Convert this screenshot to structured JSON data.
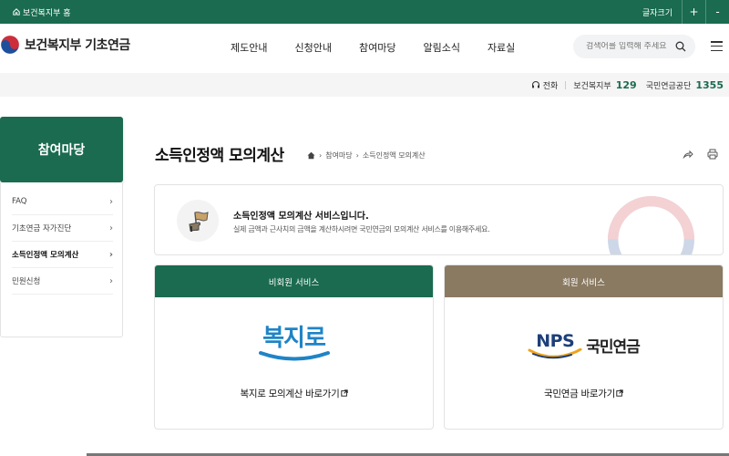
{
  "topbar": {
    "home_link": "보건복지부 홈",
    "font_size_label": "글자크기",
    "font_plus": "+",
    "font_minus": "-"
  },
  "header": {
    "logo_text": "보건복지부 기초연금",
    "nav": [
      "제도안내",
      "신청안내",
      "참여마당",
      "알림소식",
      "자료실"
    ],
    "search_placeholder": "검색어를 입력해 주세요"
  },
  "contact": {
    "phone_label": "전화",
    "mohw_label": "보건복지부",
    "mohw_number": "129",
    "nps_label": "국민연금공단",
    "nps_number": "1355"
  },
  "sidebar": {
    "title": "참여마당",
    "items": [
      {
        "label": "FAQ"
      },
      {
        "label": "기초연금 자가진단"
      },
      {
        "label": "소득인정액 모의계산"
      },
      {
        "label": "민원신청"
      }
    ]
  },
  "main": {
    "page_title": "소득인정액 모의계산",
    "breadcrumb": [
      "참여마당",
      "소득인정액 모의계산"
    ],
    "info_title": "소득인정액 모의계산 서비스입니다.",
    "info_desc": "실제 금액과 근사치의 금액을 계산하시려면 국민연금의 모의계산 서비스를 이용해주세요.",
    "cards": [
      {
        "header": "비회원 서비스",
        "logo_text": "복지로",
        "link": "복지로 모의계산 바로가기"
      },
      {
        "header": "회원 서비스",
        "logo_text_en": "NPS",
        "logo_text_kr": "국민연금",
        "link": "국민연금 바로가기"
      }
    ]
  },
  "colors": {
    "primary_green": "#1a6b4f",
    "member_brown": "#8a7a62",
    "bokjiro_blue": "#1f84c6",
    "nps_navy": "#1d3f7a"
  }
}
